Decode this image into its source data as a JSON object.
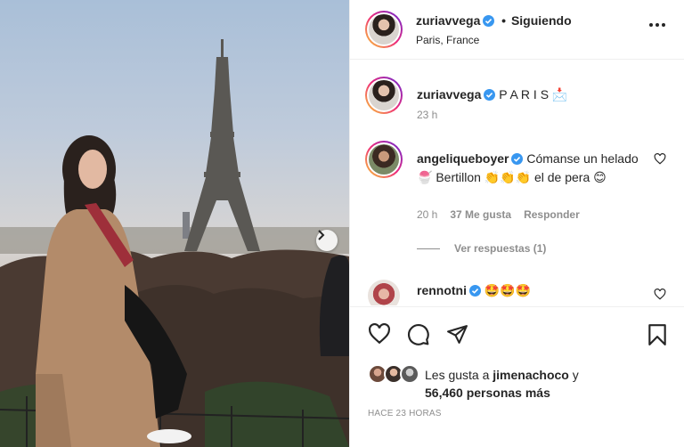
{
  "post": {
    "username": "zuriavvega",
    "follow_status": "Siguiendo",
    "location": "Paris, France"
  },
  "caption": {
    "username": "zuriavvega",
    "text": "P A R I S 📩",
    "time": "23 h"
  },
  "comments": [
    {
      "username": "angeliqueboyer",
      "text": "Cómanse un helado 🍧 Bertillon 👏👏👏 el de pera 😊",
      "time": "20 h",
      "likes": "37 Me gusta",
      "reply_label": "Responder",
      "view_replies": "Ver respuestas (1)"
    },
    {
      "username": "rennotni",
      "text": "🤩🤩🤩"
    }
  ],
  "likes": {
    "prefix": "Les gusta a",
    "user": "jimenachoco",
    "conj": "y",
    "count": "56,460 personas más"
  },
  "timestamp": "HACE 23 HORAS",
  "colors": {
    "verified": "#3897f0",
    "muted": "#8e8e8e",
    "text": "#262626"
  }
}
